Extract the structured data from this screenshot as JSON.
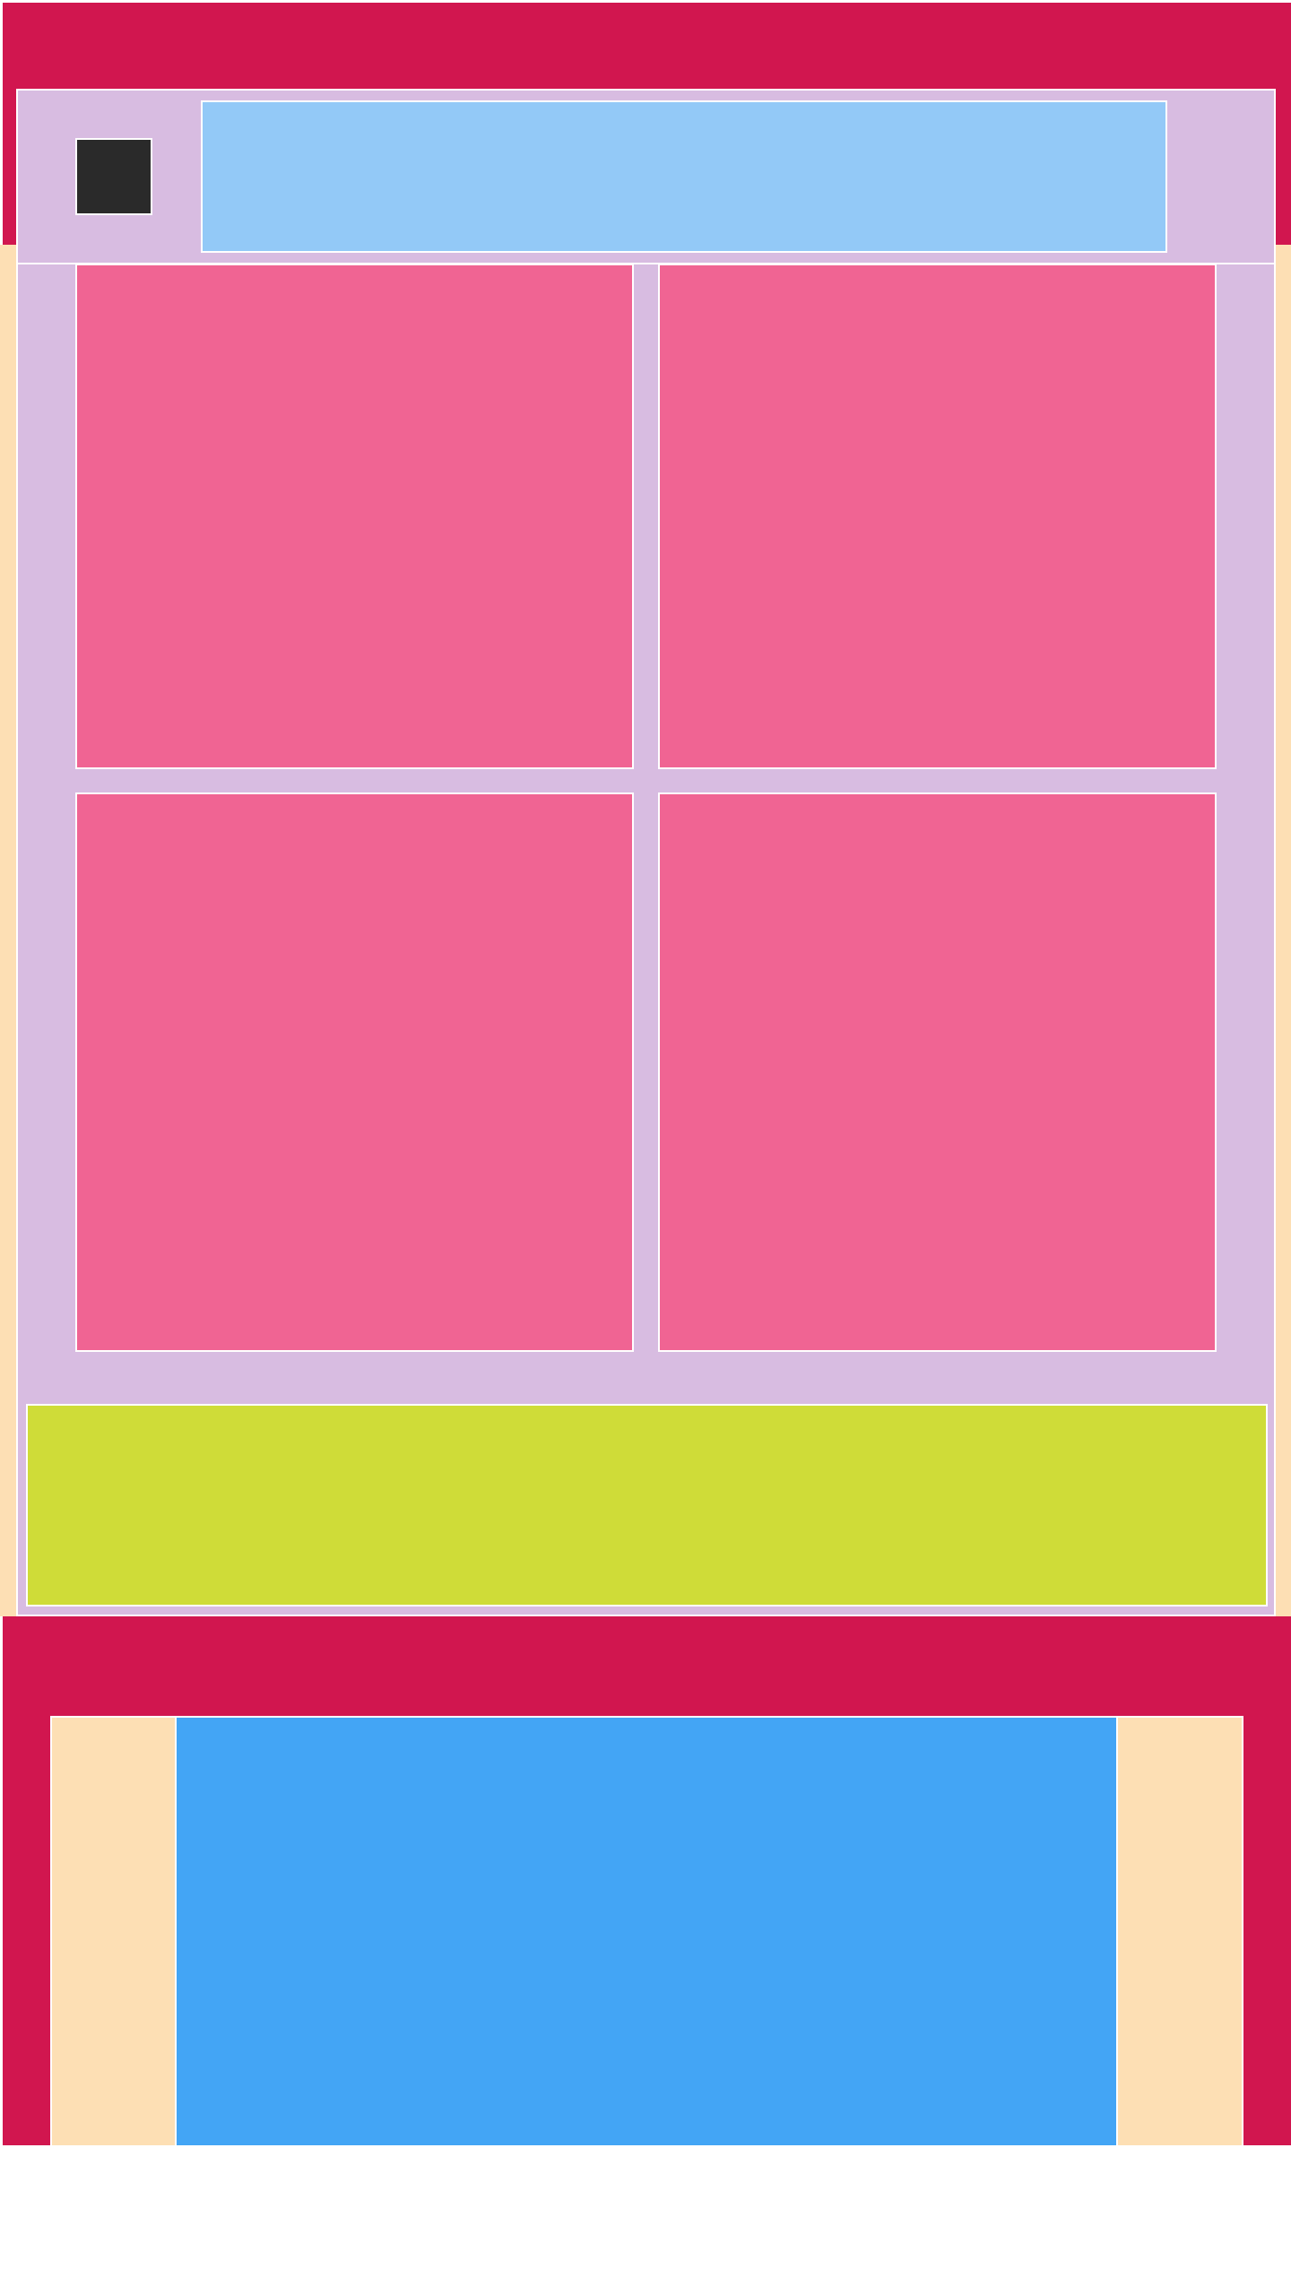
{
  "colors": {
    "brand": "#D1164F",
    "cream": "#FDDFB4",
    "panel": "#D8BCE1",
    "sky": "#93C9F7",
    "dark": "#2A2A2A",
    "tile": "#F06493",
    "lime": "#CFDC38",
    "blue": "#43A5F5"
  },
  "header": {
    "logo_icon": "logo-mark",
    "banner_text": ""
  },
  "tiles": [
    {
      "label": ""
    },
    {
      "label": ""
    },
    {
      "label": ""
    },
    {
      "label": ""
    }
  ],
  "cta": {
    "label": ""
  },
  "footer": {
    "media_label": ""
  }
}
